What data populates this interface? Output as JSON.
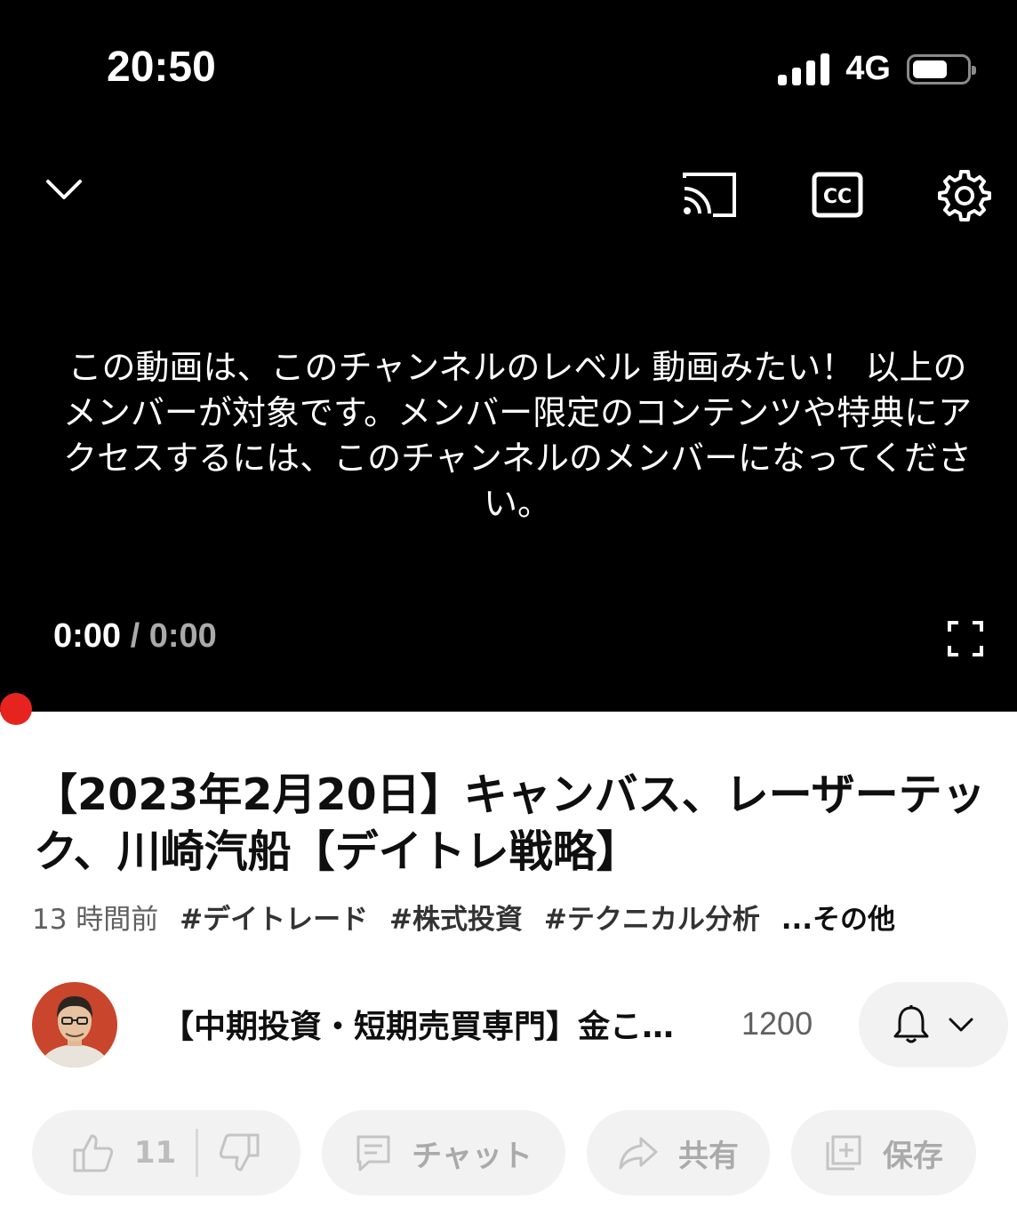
{
  "status_bar": {
    "time": "20:50",
    "network": "4G"
  },
  "player": {
    "message": "この動画は、このチャンネルのレベル 動画みたい！ 以上のメンバーが対象です。メンバー限定のコンテンツや特典にアクセスするには、このチャンネルのメンバーになってください。",
    "current_time": "0:00",
    "separator": "/",
    "duration": "0:00",
    "progress": 0
  },
  "video": {
    "title": "【2023年2月20日】キャンバス、レーザーテック、川崎汽船【デイトレ戦略】",
    "age": "13 時間前",
    "hashtags": [
      "#デイトレード",
      "#株式投資",
      "#テクニカル分析"
    ],
    "more_label": "...その他"
  },
  "channel": {
    "name": "【中期投資・短期売買専門】金こ…",
    "subscribers": "1200"
  },
  "actions": {
    "like_count": "11",
    "chat_label": "チャット",
    "share_label": "共有",
    "save_label": "保存"
  },
  "colors": {
    "progress": "#e52420",
    "player_bg": "#000000",
    "pill_bg": "#f2f2f2"
  }
}
